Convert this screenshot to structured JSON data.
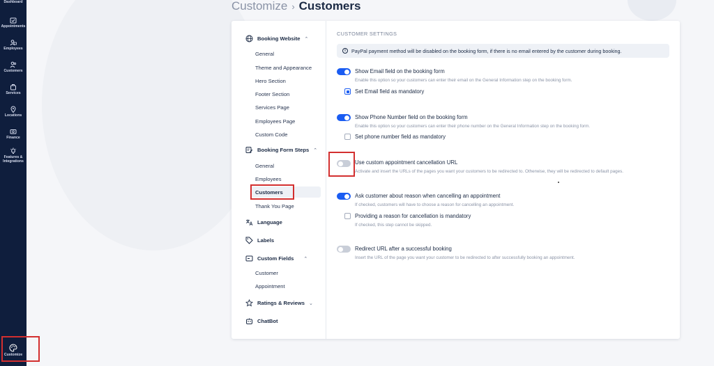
{
  "rail": {
    "items": [
      {
        "label": "Dashboard",
        "icon": "dashboard-icon"
      },
      {
        "label": "Appointments",
        "icon": "calendar-check-icon"
      },
      {
        "label": "Employees",
        "icon": "employees-icon"
      },
      {
        "label": "Customers",
        "icon": "customers-icon"
      },
      {
        "label": "Services",
        "icon": "services-icon"
      },
      {
        "label": "Locations",
        "icon": "location-pin-icon"
      },
      {
        "label": "Finance",
        "icon": "finance-icon"
      },
      {
        "label": "Features & Integrations",
        "icon": "bulb-icon"
      },
      {
        "label": "Customize",
        "icon": "palette-icon"
      }
    ]
  },
  "header": {
    "crumb": "Customize",
    "separator": "›",
    "current": "Customers"
  },
  "subnav": {
    "booking_website": {
      "label": "Booking Website",
      "items": [
        "General",
        "Theme and Appearance",
        "Hero Section",
        "Footer Section",
        "Services Page",
        "Employees Page",
        "Custom Code"
      ]
    },
    "booking_form_steps": {
      "label": "Booking Form Steps",
      "items": [
        "General",
        "Employees",
        "Customers",
        "Thank You Page"
      ],
      "active": "Customers"
    },
    "language": "Language",
    "labels": "Labels",
    "custom_fields": {
      "label": "Custom Fields",
      "items": [
        "Customer",
        "Appointment"
      ]
    },
    "ratings": "Ratings & Reviews",
    "chatbot": "ChatBot"
  },
  "settings": {
    "section_title": "CUSTOMER SETTINGS",
    "info": "PayPal payment method will be disabled on the booking form, if there is no email entered by the customer during booking.",
    "options": [
      {
        "label": "Show Email field on the booking form",
        "desc": "Enable this option so your customers can enter their email on the General Information step on the booking form.",
        "enabled": true,
        "sub": {
          "label": "Set Email field as mandatory",
          "checked": true
        }
      },
      {
        "label": "Show Phone Number field on the booking form",
        "desc": "Enable this option so your customers can enter their phone number on the General Information step on the booking form.",
        "enabled": true,
        "sub": {
          "label": "Set phone number field as mandatory",
          "checked": false
        }
      },
      {
        "label": "Use custom appointment cancellation URL",
        "desc": "Activate and insert the URLs of the pages you want your customers to be redirected to. Otherwise, they will be redirected to default pages.",
        "enabled": false
      },
      {
        "label": "Ask customer about reason when cancelling an appointment",
        "desc": "If checked, customers will have to choose a reason for cancelling an appointment.",
        "enabled": true,
        "sub": {
          "label": "Providing a reason for cancellation is mandatory",
          "desc": "If checked, this step cannot be skipped.",
          "checked": false
        }
      },
      {
        "label": "Redirect URL after a successful booking",
        "desc": "Insert the URL of the page you want your customer to be redirected to after successfully booking an appointment.",
        "enabled": false
      }
    ]
  },
  "colors": {
    "rail": "#0f1e3d",
    "accent": "#1a5cf2",
    "highlight": "#d32f2f"
  }
}
